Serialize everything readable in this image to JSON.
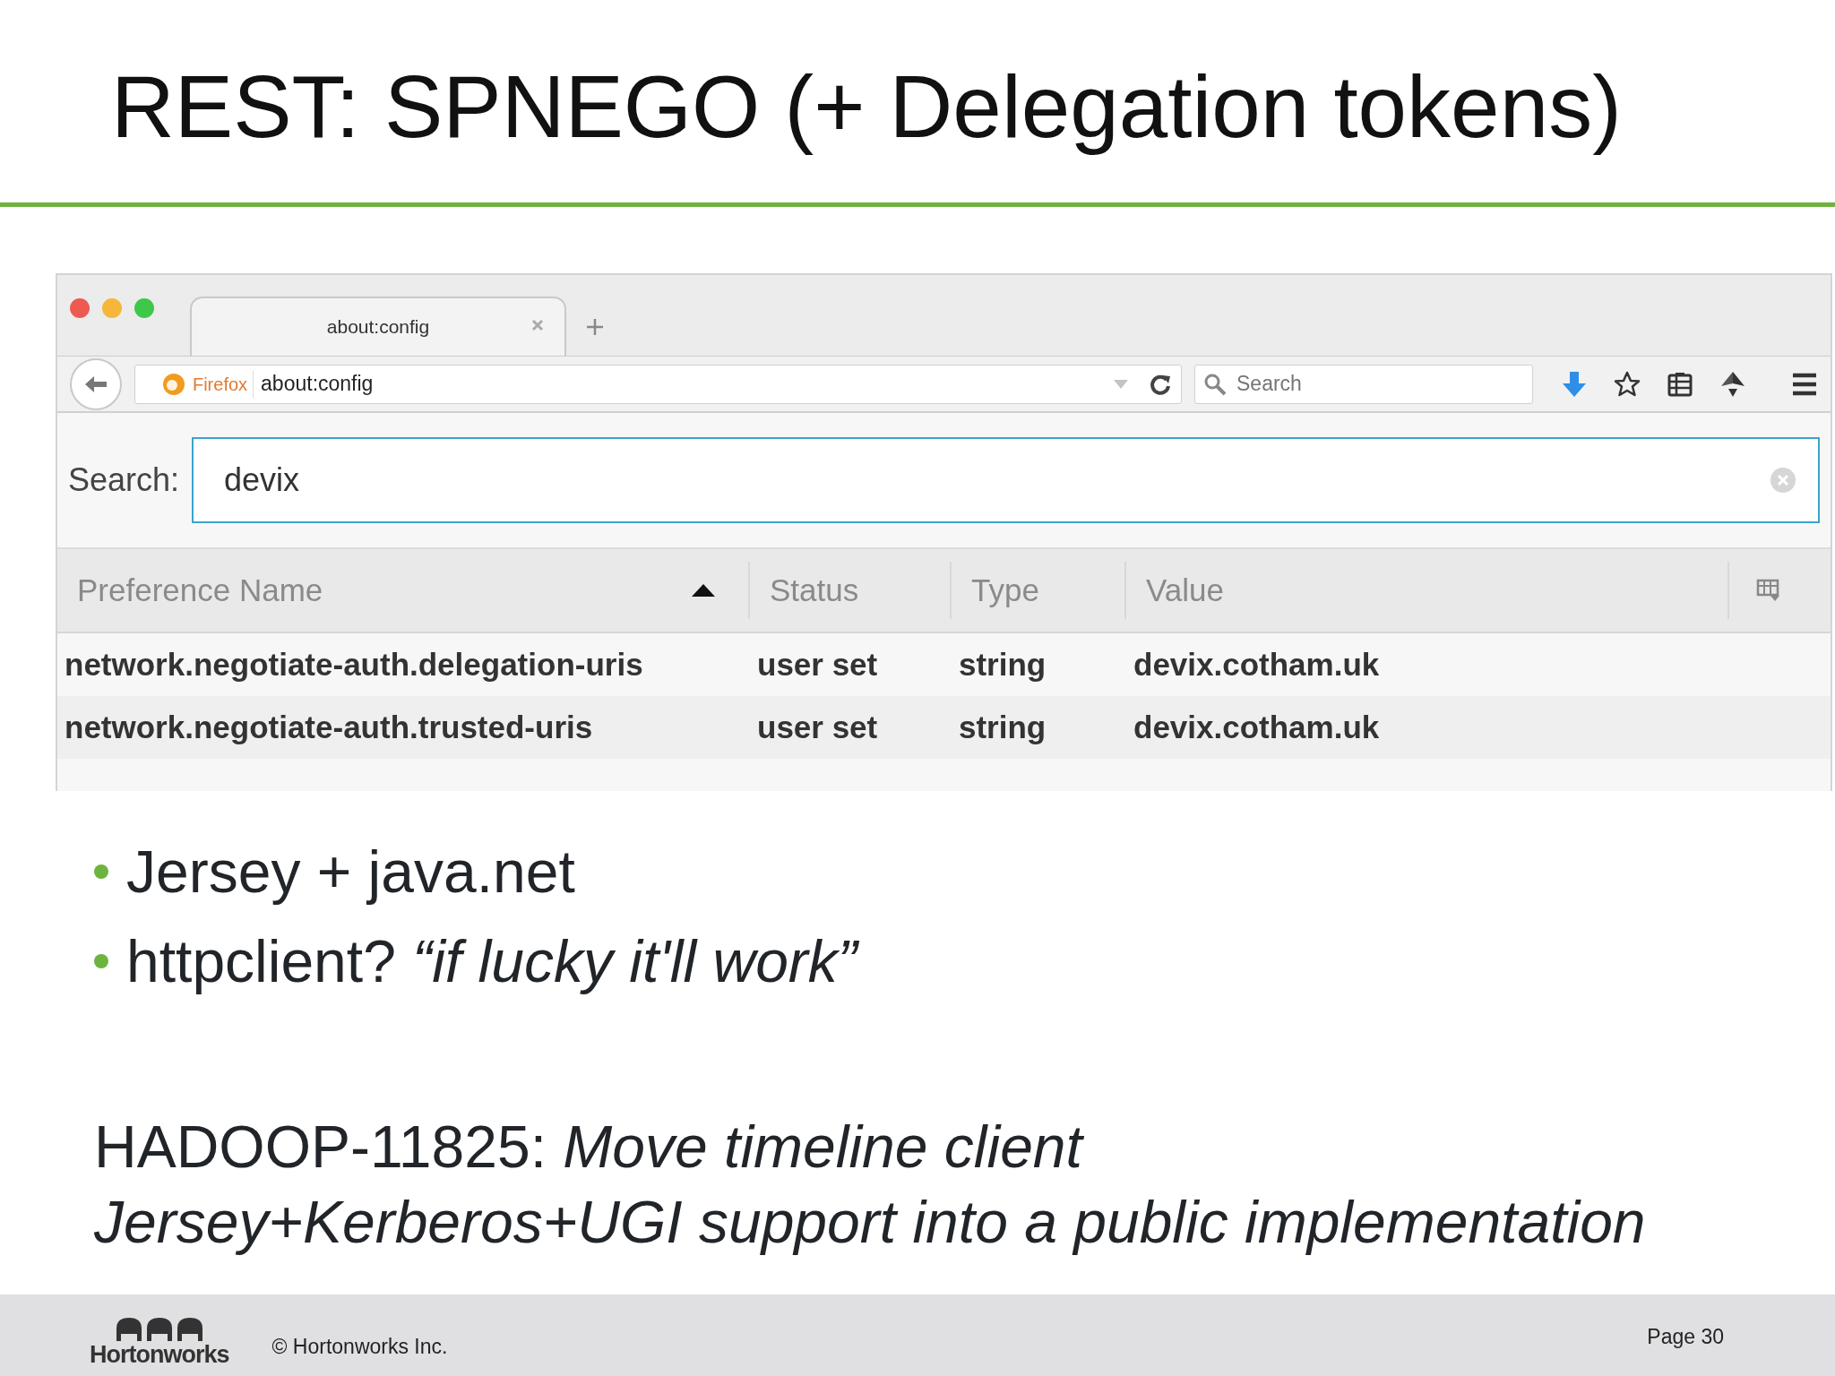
{
  "slide_title": "REST: SPNEGO (+ Delegation tokens)",
  "browser": {
    "tab": {
      "title": "about:config",
      "selected": true
    },
    "address": {
      "identity": "Firefox",
      "url": "about:config"
    },
    "search": {
      "placeholder": "Search"
    },
    "config": {
      "search_label": "Search:",
      "search_value": "devix",
      "columns": [
        {
          "label": "Preference Name",
          "sorted": true
        },
        {
          "label": "Status",
          "sorted": false
        },
        {
          "label": "Type",
          "sorted": false
        },
        {
          "label": "Value",
          "sorted": false
        }
      ],
      "rows": [
        {
          "name": "network.negotiate-auth.delegation-uris",
          "status": "user set",
          "type": "string",
          "value": "devix.cotham.uk"
        },
        {
          "name": "network.negotiate-auth.trusted-uris",
          "status": "user set",
          "type": "string",
          "value": "devix.cotham.uk"
        }
      ]
    }
  },
  "bullets": [
    "Jersey + java.net",
    "httpclient? *“if lucky it'll work”*"
  ],
  "note_lines": [
    "HADOOP-11825: *Move timeline client*",
    "*Jersey+Kerberos+UGI support into a public implementation*"
  ],
  "footer": {
    "logo_text": "Hortonworks",
    "copyright": "© Hortonworks Inc.",
    "page": "Page 30"
  }
}
